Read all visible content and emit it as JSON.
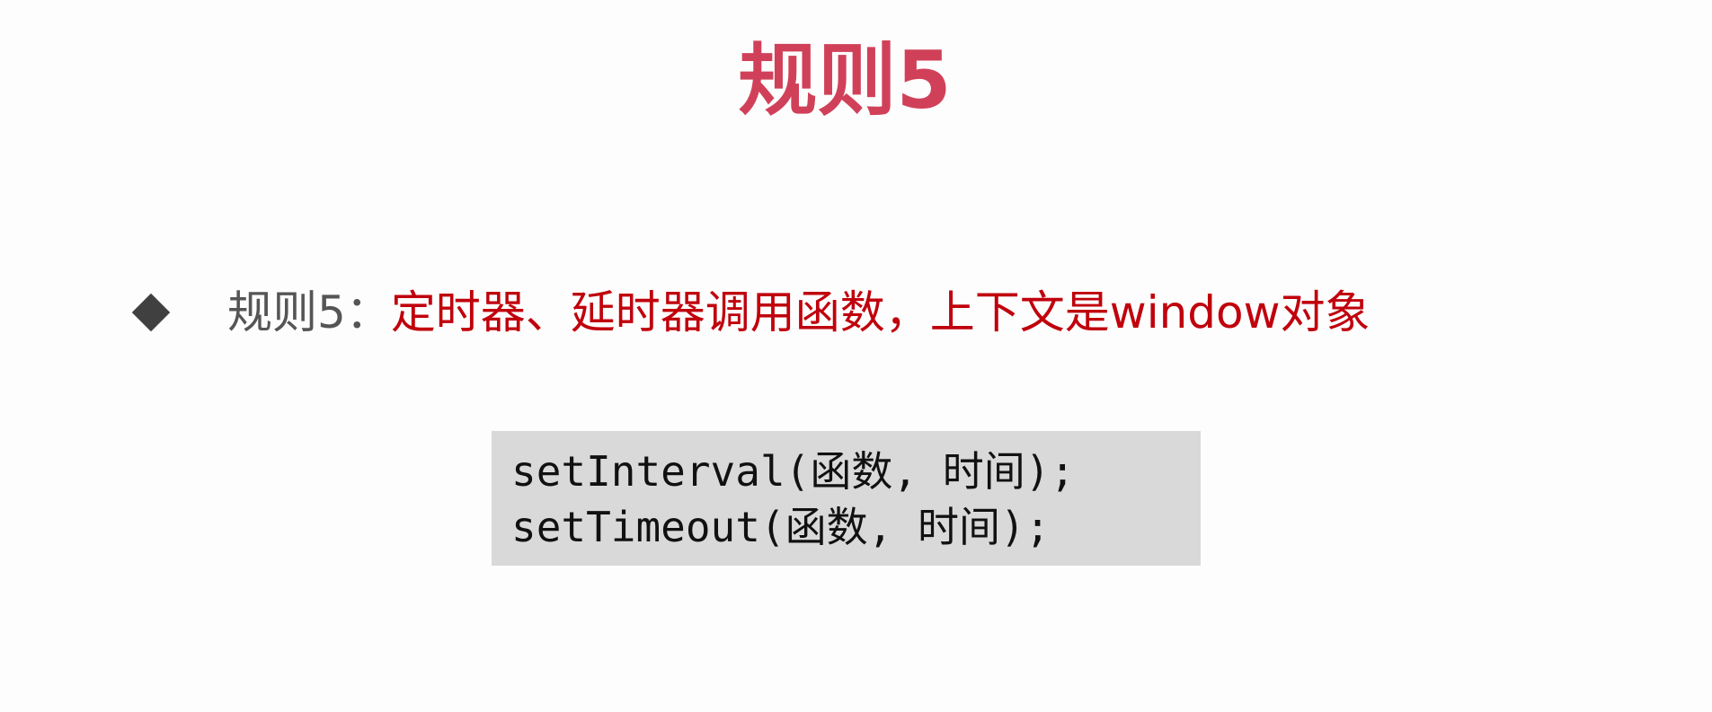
{
  "slide": {
    "title": "规则5",
    "bullet": {
      "prefix": "规则5：",
      "rule": "定时器、延时器调用函数，上下文是window对象"
    },
    "code": {
      "lines": [
        "setInterval(函数, 时间);",
        "setTimeout(函数, 时间);"
      ]
    }
  },
  "colors": {
    "title": "#d04159",
    "rule_text": "#c0000c",
    "prefix_text": "#555555",
    "code_background": "#d9d9d9",
    "bullet_diamond": "#404040"
  },
  "icons": {
    "bullet": "diamond-bullet-icon"
  }
}
